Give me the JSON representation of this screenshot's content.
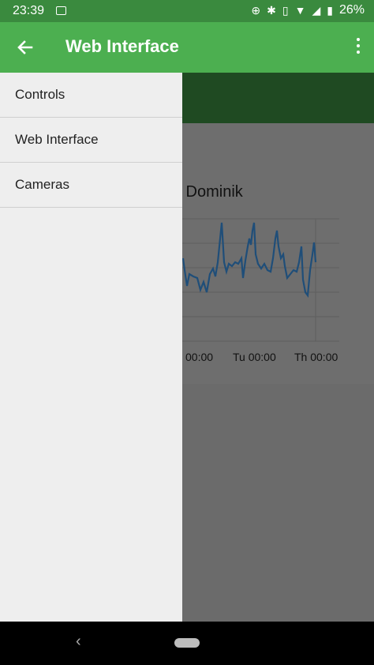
{
  "status_bar": {
    "time": "23:39",
    "battery": "26%",
    "icons": [
      "gallery-icon",
      "data-saver-icon",
      "bluetooth-icon",
      "vibrate-icon",
      "wifi-icon",
      "signal-icon",
      "battery-icon"
    ]
  },
  "app_bar": {
    "title": "Web Interface",
    "color": "#4caf50"
  },
  "drawer": {
    "items": [
      {
        "label": "Controls"
      },
      {
        "label": "Web Interface"
      },
      {
        "label": "Cameras"
      }
    ]
  },
  "background_chart": {
    "title_fragment": "re - Dominik",
    "tick_labels": [
      "00:00",
      "Tu 00:00",
      "Th 00:00"
    ],
    "line_color": "#1f4e79"
  }
}
